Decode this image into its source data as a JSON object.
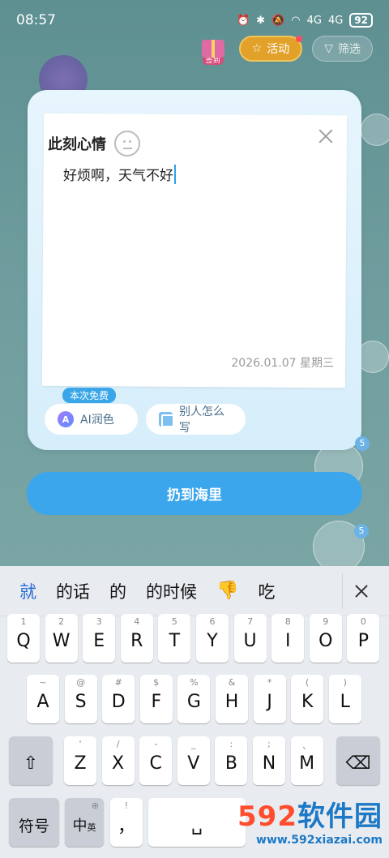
{
  "status_bar": {
    "time": "08:57",
    "signal_1": "4G",
    "signal_2": "4G",
    "battery": "92"
  },
  "top_actions": {
    "gift_label": "签到",
    "activity_label": "活动",
    "filter_label": "筛选"
  },
  "dialog": {
    "title": "此刻心情",
    "content": "好烦啊，天气不好",
    "date": "2026.01.07 星期三",
    "free_badge": "本次免费",
    "ai_button": "AI润色",
    "ai_icon_letter": "A",
    "others_button": "别人怎么写"
  },
  "primary_button": "扔到海里",
  "side_counts": [
    "5",
    "5"
  ],
  "keyboard": {
    "candidates": [
      "就",
      "的话",
      "的",
      "的时候",
      "吃"
    ],
    "emoji_candidate": "👎",
    "row1": [
      {
        "main": "Q",
        "sup": "1"
      },
      {
        "main": "W",
        "sup": "2"
      },
      {
        "main": "E",
        "sup": "3"
      },
      {
        "main": "R",
        "sup": "4"
      },
      {
        "main": "T",
        "sup": "5"
      },
      {
        "main": "Y",
        "sup": "6"
      },
      {
        "main": "U",
        "sup": "7"
      },
      {
        "main": "I",
        "sup": "8"
      },
      {
        "main": "O",
        "sup": "9"
      },
      {
        "main": "P",
        "sup": "0"
      }
    ],
    "row2": [
      {
        "main": "A",
        "sup": "~"
      },
      {
        "main": "S",
        "sup": "@"
      },
      {
        "main": "D",
        "sup": "#"
      },
      {
        "main": "F",
        "sup": "$"
      },
      {
        "main": "G",
        "sup": "%"
      },
      {
        "main": "H",
        "sup": "&"
      },
      {
        "main": "J",
        "sup": "*"
      },
      {
        "main": "K",
        "sup": "("
      },
      {
        "main": "L",
        "sup": ")"
      }
    ],
    "row3": [
      {
        "main": "Z",
        "sup": "'"
      },
      {
        "main": "X",
        "sup": "/"
      },
      {
        "main": "C",
        "sup": "-"
      },
      {
        "main": "V",
        "sup": "_"
      },
      {
        "main": "B",
        "sup": ":"
      },
      {
        "main": "N",
        "sup": ";"
      },
      {
        "main": "M",
        "sup": "、"
      }
    ],
    "symbol_key": "符号",
    "lang_key": "中",
    "lang_key_sub": "英",
    "comma_key": "，",
    "comma_sup": "!"
  },
  "watermark": {
    "logo_num": "592",
    "logo_text": "软件园",
    "url": "www.592xiazai.com"
  },
  "colors": {
    "accent": "#3ba6ec",
    "activity": "#e2a22a",
    "candidate_highlight": "#2a6bd8"
  }
}
